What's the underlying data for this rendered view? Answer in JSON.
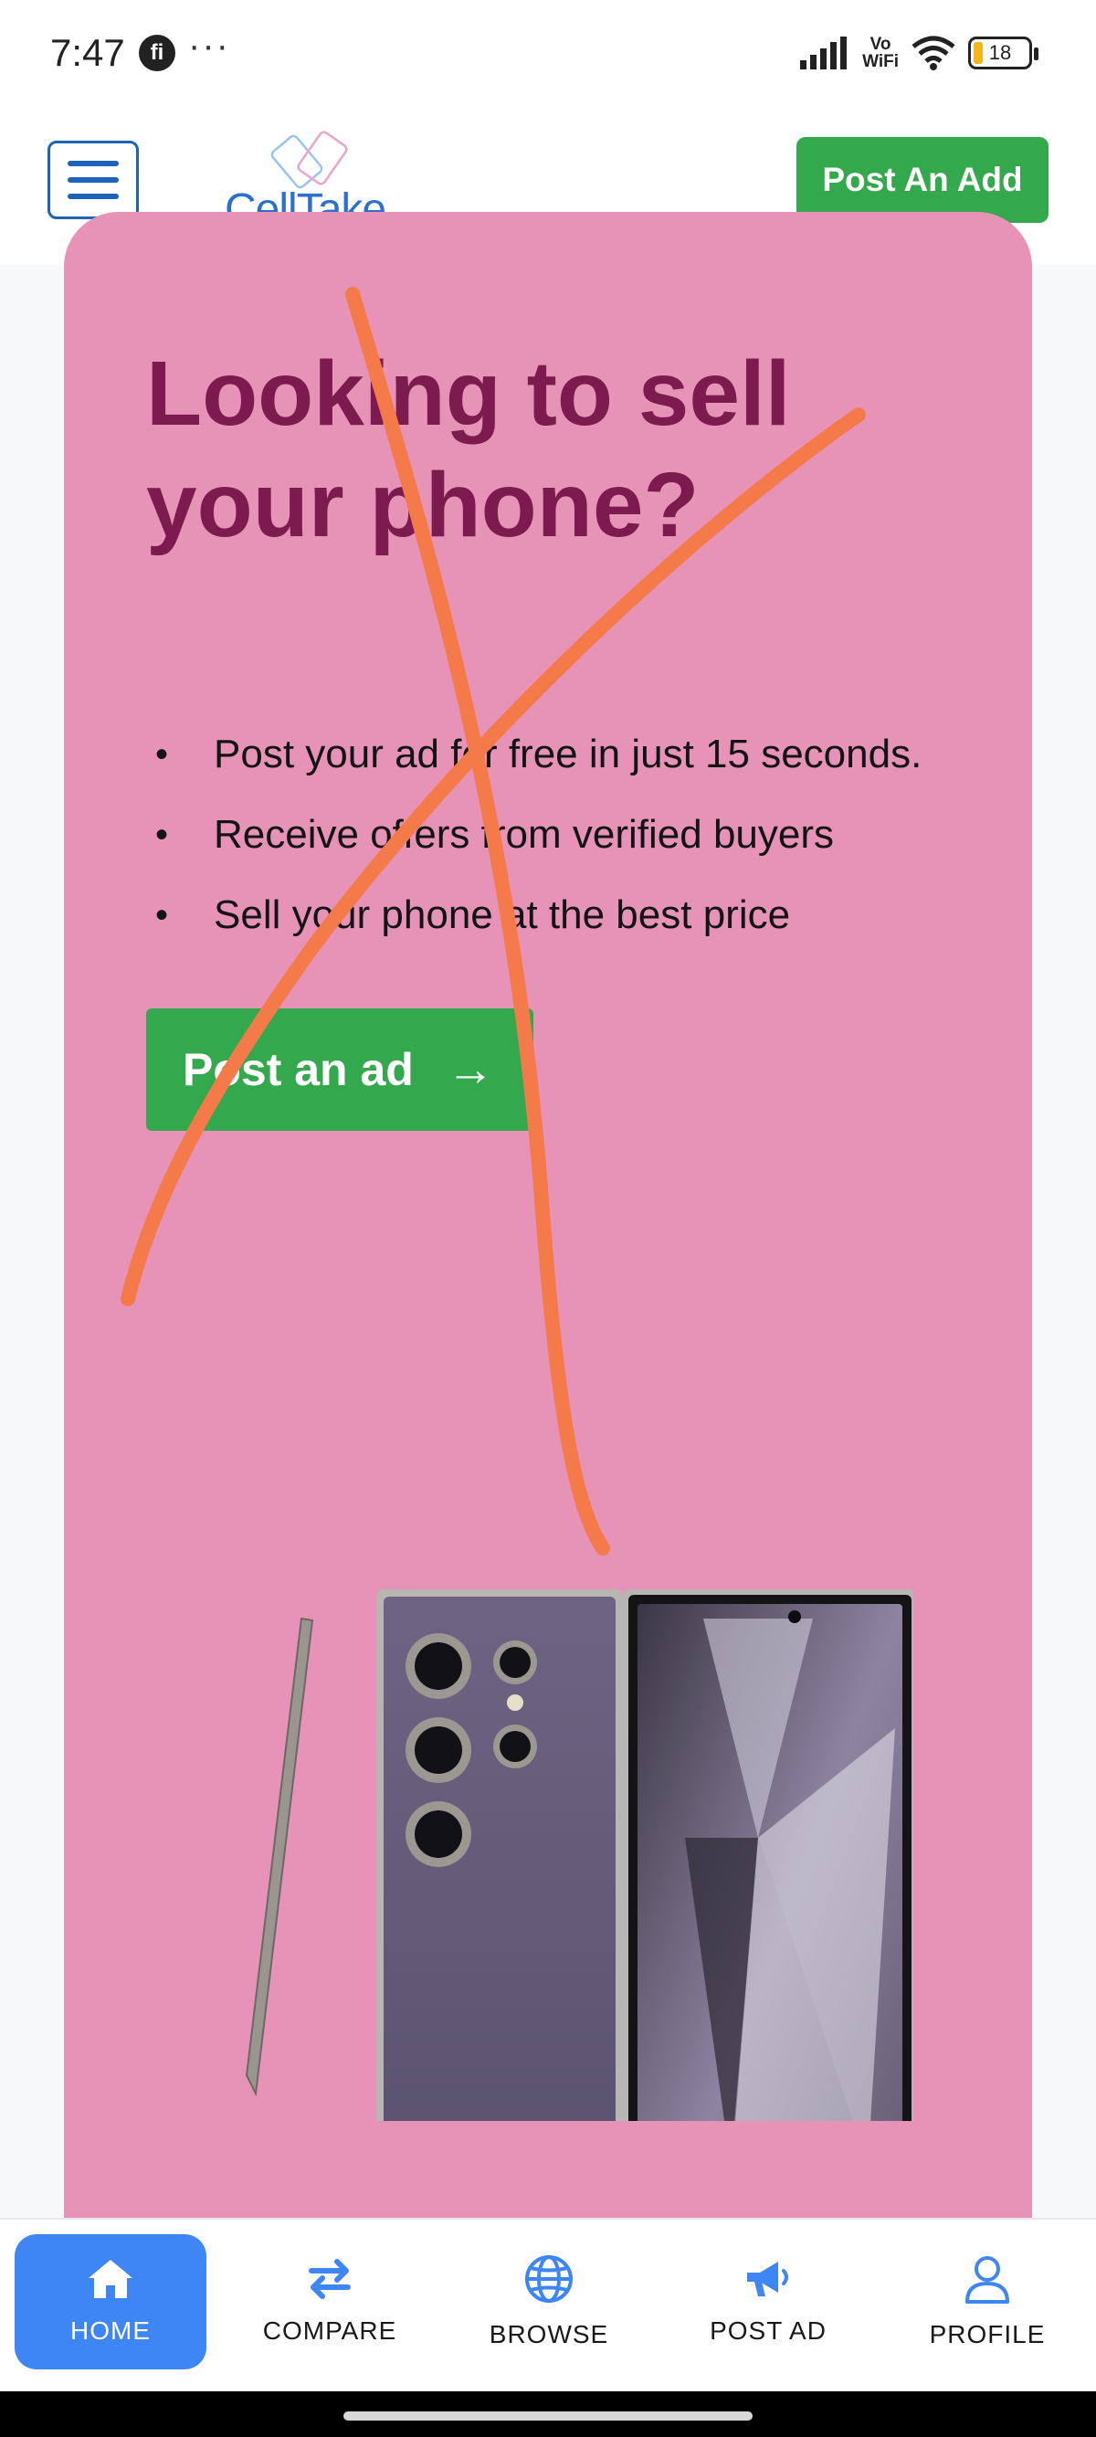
{
  "status_bar": {
    "time": "7:47",
    "app_icon": "fi",
    "more": "···",
    "vowifi_top": "Vo",
    "vowifi_bottom": "WiFi",
    "battery": "18"
  },
  "header": {
    "logo_text": "CellTake",
    "post_button": "Post An Add"
  },
  "hero": {
    "title": "Looking to sell your phone?",
    "bullets": [
      "Post your ad for free in just 15 seconds.",
      "Receive offers from verified buyers",
      "Sell your phone at the best price"
    ],
    "cta_label": "Post an ad",
    "cta_arrow": "→"
  },
  "bottom_nav": {
    "items": [
      {
        "label": "HOME",
        "icon": "home-icon",
        "active": true
      },
      {
        "label": "COMPARE",
        "icon": "compare-arrows-icon",
        "active": false
      },
      {
        "label": "BROWSE",
        "icon": "globe-icon",
        "active": false
      },
      {
        "label": "POST AD",
        "icon": "megaphone-icon",
        "active": false
      },
      {
        "label": "PROFILE",
        "icon": "user-icon",
        "active": false
      }
    ]
  },
  "colors": {
    "hero_bg": "#e793b8",
    "hero_title": "#7c1c4e",
    "green": "#34a84c",
    "nav_active": "#3f86f5",
    "scribble": "#f47a4a"
  }
}
